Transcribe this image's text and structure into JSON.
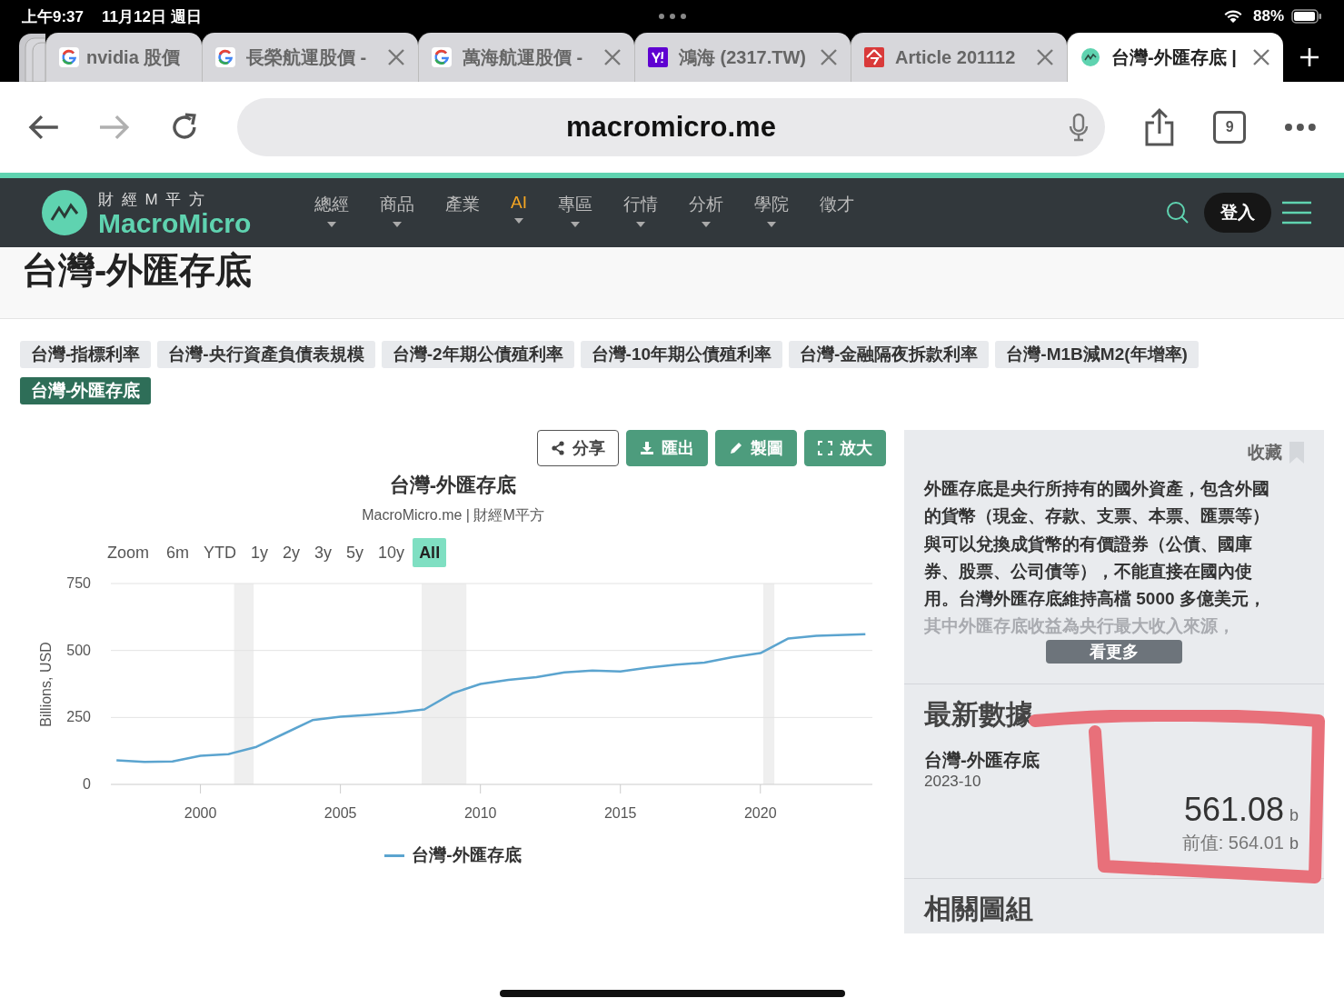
{
  "status_bar": {
    "time": "上午9:37",
    "date": "11月12日 週日",
    "battery": "88%"
  },
  "browser_tabs": [
    {
      "title": "nvidia 股價",
      "kind": "google",
      "selected": false
    },
    {
      "title": "長榮航運股價 -",
      "kind": "google",
      "selected": false
    },
    {
      "title": "萬海航運股價 -",
      "kind": "google",
      "selected": false
    },
    {
      "title": "鴻海 (2317.TW)",
      "kind": "yahoo",
      "selected": false
    },
    {
      "title": "Article 201112",
      "kind": "article",
      "selected": false
    },
    {
      "title": "台灣-外匯存底 |",
      "kind": "macromicro",
      "selected": true
    }
  ],
  "address_bar": {
    "url": "macromicro.me",
    "tab_count": "9"
  },
  "site_nav": {
    "logo_subtitle": "財 經 M 平 方",
    "logo_title": "MacroMicro",
    "login": "登入",
    "items": [
      {
        "label": "總經",
        "dropdown": true,
        "highlight": false
      },
      {
        "label": "商品",
        "dropdown": true,
        "highlight": false
      },
      {
        "label": "產業",
        "dropdown": false,
        "highlight": false
      },
      {
        "label": "AI",
        "dropdown": true,
        "highlight": true
      },
      {
        "label": "專區",
        "dropdown": true,
        "highlight": false
      },
      {
        "label": "行情",
        "dropdown": true,
        "highlight": false
      },
      {
        "label": "分析",
        "dropdown": true,
        "highlight": false
      },
      {
        "label": "學院",
        "dropdown": true,
        "highlight": false
      },
      {
        "label": "徵才",
        "dropdown": false,
        "highlight": false
      }
    ]
  },
  "page_title": "台灣-外匯存底",
  "related_tags": [
    {
      "label": "台灣-指標利率",
      "selected": false
    },
    {
      "label": "台灣-央行資產負債表規模",
      "selected": false
    },
    {
      "label": "台灣-2年期公債殖利率",
      "selected": false
    },
    {
      "label": "台灣-10年期公債殖利率",
      "selected": false
    },
    {
      "label": "台灣-金融隔夜拆款利率",
      "selected": false
    },
    {
      "label": "台灣-M1B減M2(年增率)",
      "selected": false
    },
    {
      "label": "台灣-外匯存底",
      "selected": true
    }
  ],
  "chart_toolbar": [
    {
      "label": "分享",
      "kind": "share"
    },
    {
      "label": "匯出",
      "kind": "export"
    },
    {
      "label": "製圖",
      "kind": "edit"
    },
    {
      "label": "放大",
      "kind": "expand"
    }
  ],
  "chart": {
    "title": "台灣-外匯存底",
    "subtitle": "MacroMicro.me | 財經M平方",
    "zoom_label": "Zoom",
    "ranges": [
      {
        "label": "6m",
        "selected": false
      },
      {
        "label": "YTD",
        "selected": false
      },
      {
        "label": "1y",
        "selected": false
      },
      {
        "label": "2y",
        "selected": false
      },
      {
        "label": "3y",
        "selected": false
      },
      {
        "label": "5y",
        "selected": false
      },
      {
        "label": "10y",
        "selected": false
      },
      {
        "label": "All",
        "selected": true
      }
    ],
    "chart_data": {
      "type": "line",
      "ylabel": "Billions, USD",
      "xlim": [
        1996.8,
        2024
      ],
      "ylim": [
        0,
        750
      ],
      "xticks": [
        2000,
        2005,
        2010,
        2015,
        2020
      ],
      "yticks": [
        0,
        250,
        500,
        750
      ],
      "x": [
        1997,
        1998,
        1999,
        2000,
        2001,
        2002,
        2003,
        2004,
        2005,
        2006,
        2007,
        2008,
        2009,
        2010,
        2011,
        2012,
        2013,
        2014,
        2015,
        2016,
        2017,
        2018,
        2019,
        2020,
        2021,
        2022,
        2023.75
      ],
      "series": [
        {
          "name": "台灣-外匯存底",
          "color": "#5ba4cf",
          "values": [
            90,
            84,
            86,
            107,
            113,
            140,
            190,
            240,
            253,
            260,
            268,
            280,
            340,
            375,
            390,
            400,
            418,
            425,
            422,
            436,
            447,
            455,
            475,
            490,
            545,
            555,
            561
          ]
        }
      ]
    }
  },
  "info_panel": {
    "bookmark": "收藏",
    "description": [
      "外匯存底是央行所持有的國外資產，包含外國",
      "的貨幣（現金、存款、支票、本票、匯票等）",
      "與可以兌換成貨幣的有價證券（公債、國庫",
      "券、股票、公司債等），不能直接在國內使",
      "用。台灣外匯存底維持高檔 5000 多億美元，"
    ],
    "description_faded": "其中外匯存底收益為央行最大收入來源，",
    "more_button": "看更多",
    "latest_heading": "最新數據",
    "series_name": "台灣-外匯存底",
    "date": "2023-10",
    "value": "561.08",
    "unit": "b",
    "previous": "前值: 564.01",
    "previous_unit": "b",
    "related_heading": "相關圖組"
  }
}
